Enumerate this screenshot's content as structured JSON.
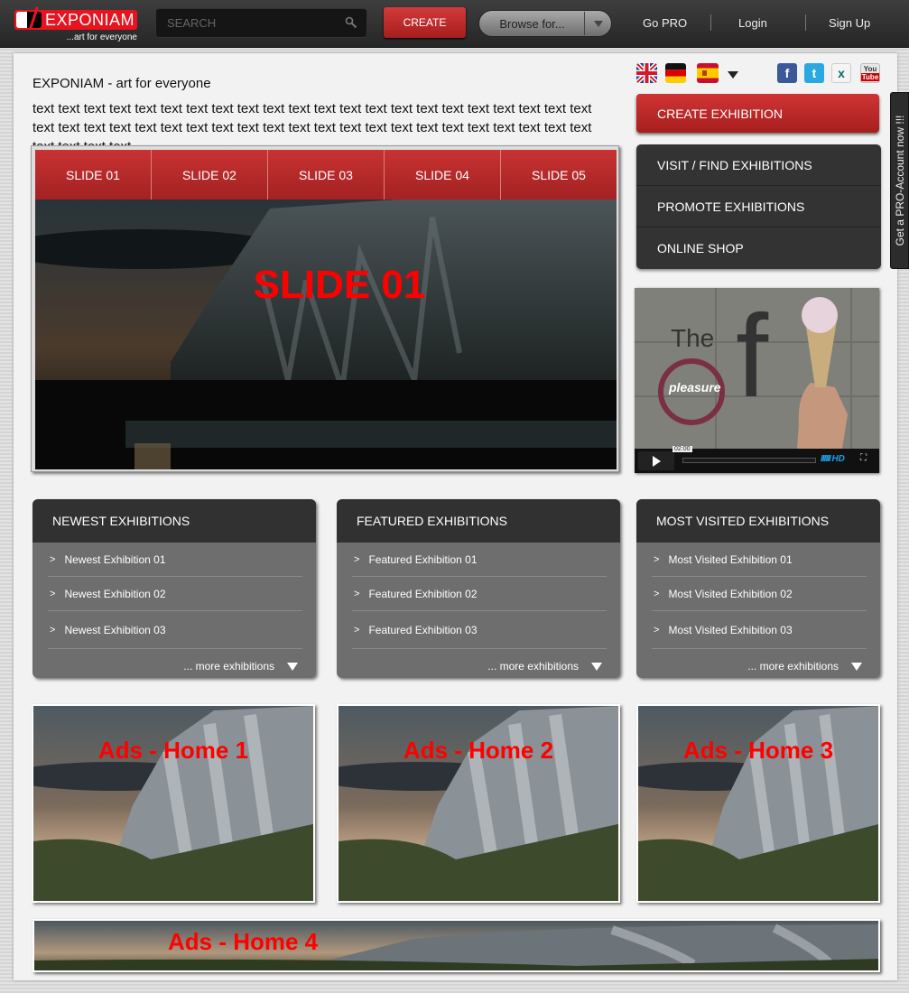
{
  "header": {
    "logo_name": "EXPONIAM",
    "logo_tagline": "...art for everyone",
    "search_placeholder": "SEARCH",
    "create_label": "CREATE",
    "browse_label": "Browse for...",
    "nav": [
      "Go PRO",
      "Login",
      "Sign Up"
    ]
  },
  "intro": {
    "headline": "EXPONIAM - art for everyone",
    "body": "text text text text text text text text text text text text text text text text text text text text text text text text text text text text text text text text text text text text text text text text text text text text text text text text"
  },
  "languages": [
    "english-flag",
    "german-flag",
    "spanish-flag"
  ],
  "social": [
    "facebook",
    "twitter",
    "xing",
    "youtube"
  ],
  "sidebar": {
    "cta_label": "CREATE EXHIBITION",
    "menu": [
      "VISIT / FIND EXHIBITIONS",
      "PROMOTE EXHIBITIONS",
      "ONLINE SHOP"
    ],
    "pro_tab": "Get a PRO-Account now !!!"
  },
  "slider": {
    "tabs": [
      "SLIDE 01",
      "SLIDE 02",
      "SLIDE 03",
      "SLIDE 04",
      "SLIDE 05"
    ],
    "active_title": "SLIDE 01"
  },
  "video": {
    "title_the": "The",
    "title_f": "f",
    "title_pleasure": "pleasure",
    "time": "02:00",
    "hd_label": "HD",
    "accent": "#1ea0e6"
  },
  "boxes": [
    {
      "title": "NEWEST EXHIBITIONS",
      "items": [
        "Newest Exhibition 01",
        "Newest Exhibition 02",
        "Newest Exhibition 03"
      ],
      "more": "... more exhibitions"
    },
    {
      "title": "FEATURED EXHIBITIONS",
      "items": [
        "Featured Exhibition 01",
        "Featured Exhibition 02",
        "Featured Exhibition 03"
      ],
      "more": "... more exhibitions"
    },
    {
      "title": "MOST VISITED EXHIBITIONS",
      "items": [
        "Most Visited Exhibition 01",
        "Most Visited Exhibition 02",
        "Most Visited Exhibition 03"
      ],
      "more": "... more exhibitions"
    }
  ],
  "ads": [
    "Ads - Home 1",
    "Ads - Home 2",
    "Ads - Home 3",
    "Ads - Home 4"
  ],
  "colors": {
    "brand_red": "#e8131f",
    "button_red": "#c23030",
    "dark_panel": "#333333"
  }
}
